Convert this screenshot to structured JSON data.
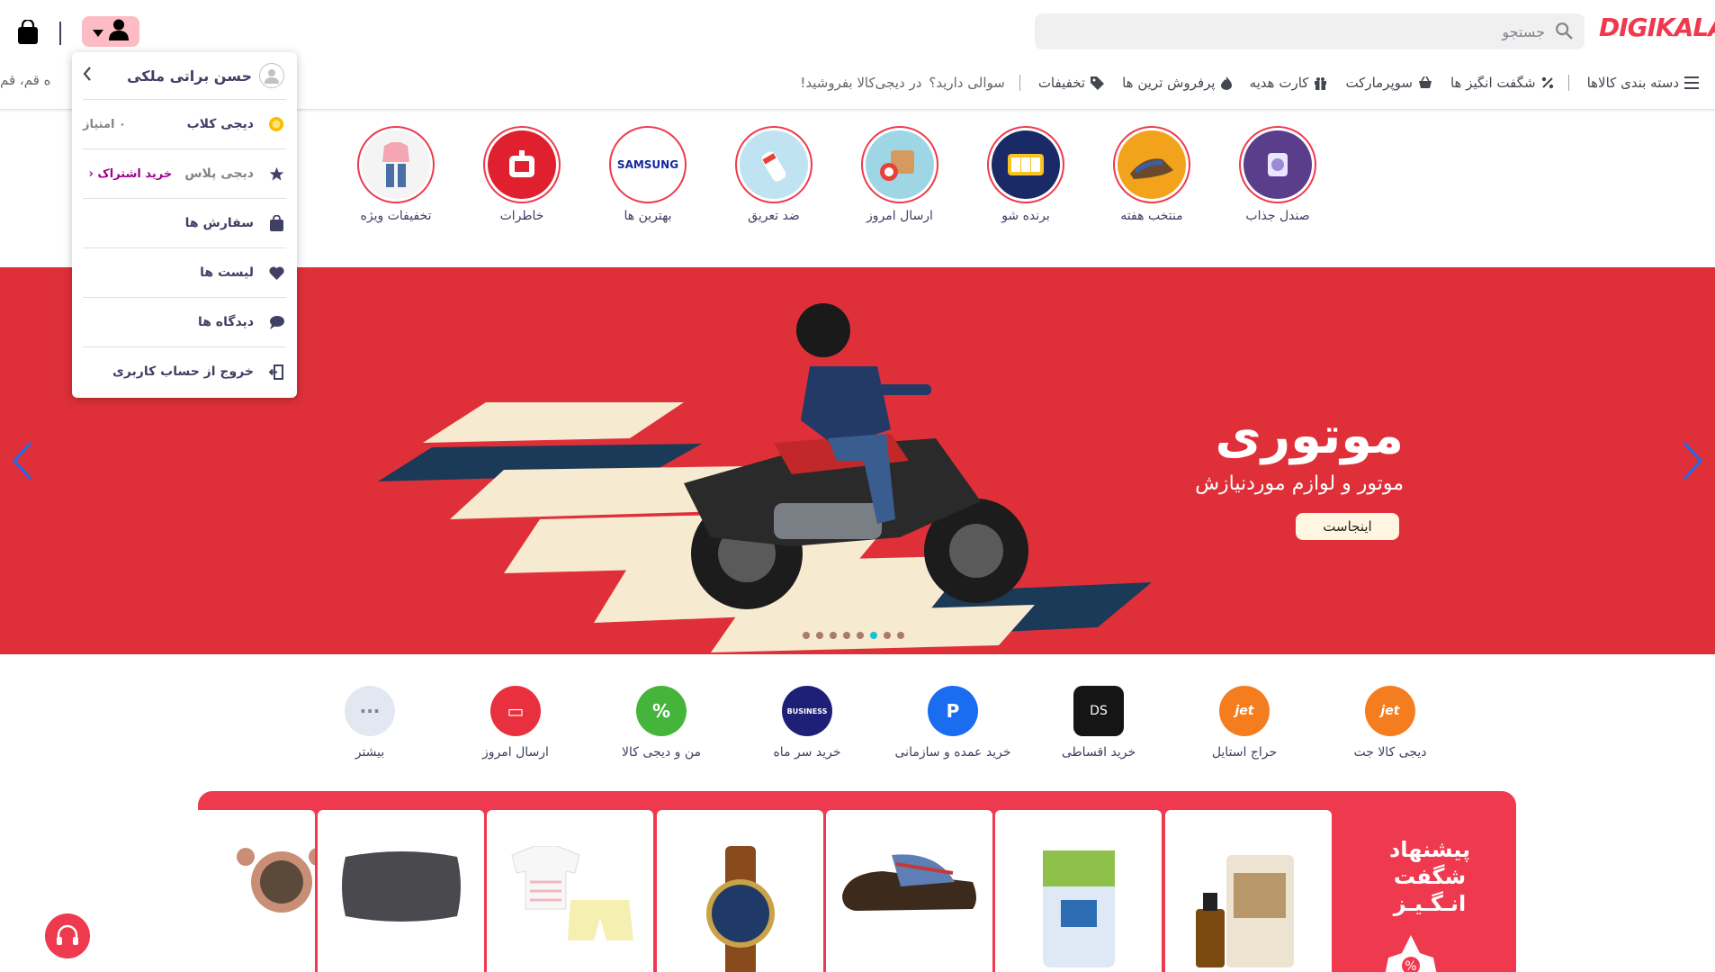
{
  "header": {
    "logo": "DIGIKALA",
    "search_placeholder": "جستجو",
    "location_text": "ه قم، قم",
    "nav": [
      {
        "label": "دسته بندی کالاها",
        "icon": "menu-icon"
      },
      {
        "label": "شگفت انگیز ها",
        "icon": "percent-icon"
      },
      {
        "label": "سوپرمارکت",
        "icon": "basket-icon"
      },
      {
        "label": "کارت هدیه",
        "icon": "gift-icon"
      },
      {
        "label": "پرفروش ترین ها",
        "icon": "fire-icon"
      },
      {
        "label": "تخفیفات",
        "icon": "tag-icon"
      }
    ],
    "nav_plain": [
      "سوالی دارید؟",
      "در دیجی‌کالا بفروشید!"
    ]
  },
  "profile_menu": {
    "user_name": "حسن براتی ملکی",
    "items": [
      {
        "label": "دیجی کلاب",
        "extra": "۰ امتیاز",
        "icon": "club-icon"
      },
      {
        "label": "دیجی پلاس",
        "extra": "خرید اشتراک ‹",
        "icon": "star-icon"
      },
      {
        "label": "سفارش ها",
        "icon": "bag-icon"
      },
      {
        "label": "لیست ها",
        "icon": "heart-icon"
      },
      {
        "label": "دیدگاه ها",
        "icon": "comment-icon"
      },
      {
        "label": "خروج از حساب کاربری",
        "icon": "logout-icon"
      }
    ]
  },
  "stories": [
    {
      "label": "صندل جذاب",
      "color": "#5a3e8c"
    },
    {
      "label": "منتخب هفته",
      "color": "#f2a31b"
    },
    {
      "label": "برنده شو",
      "color": "#1a2a66"
    },
    {
      "label": "ارسال امروز",
      "color": "#9fd6e6"
    },
    {
      "label": "ضد تعریق",
      "color": "#bfe3f0"
    },
    {
      "label": "بهترین ها",
      "color": "#ffffff",
      "text": "SAMSUNG"
    },
    {
      "label": "خاطرات",
      "color": "#e0202e"
    },
    {
      "label": "تخفیفات ویژه",
      "color": "#f4f4f4"
    }
  ],
  "hero": {
    "title": "موتوری",
    "subtitle": "موتور و لوازم موردنیازش",
    "button": "اینجاست",
    "slide_count": 8,
    "active_slide": 6
  },
  "services": [
    {
      "label": "دیجی کالا جت",
      "color": "#f47d20",
      "glyph": "jet"
    },
    {
      "label": "حراج استایل",
      "color": "#f47d20",
      "glyph": "jet"
    },
    {
      "label": "خرید اقساطی",
      "color": "#151515",
      "glyph": "DS"
    },
    {
      "label": "خرید عمده و سازمانی",
      "color": "#1a6cf0",
      "glyph": "P"
    },
    {
      "label": "خرید سر ماه",
      "color": "#1e2078",
      "glyph": "BUSINESS"
    },
    {
      "label": "من و دیجی کالا",
      "color": "#45b43a",
      "glyph": "%"
    },
    {
      "label": "ارسال امروز",
      "color": "#e8303e",
      "glyph": "▭"
    },
    {
      "label": "بیشتر",
      "color": "#e3e7f1",
      "glyph": "···"
    }
  ],
  "amazing": {
    "title_line1": "پیشنهاد",
    "title_line2": "شگفت",
    "title_line3": "انـگـیـز",
    "products": [
      "honey-product",
      "pads-product",
      "slipper-product",
      "watch-product",
      "kids-clothes-product",
      "pillow-product",
      "sunglasses-product"
    ]
  },
  "sidebar_badge": {
    "percent": "%"
  }
}
